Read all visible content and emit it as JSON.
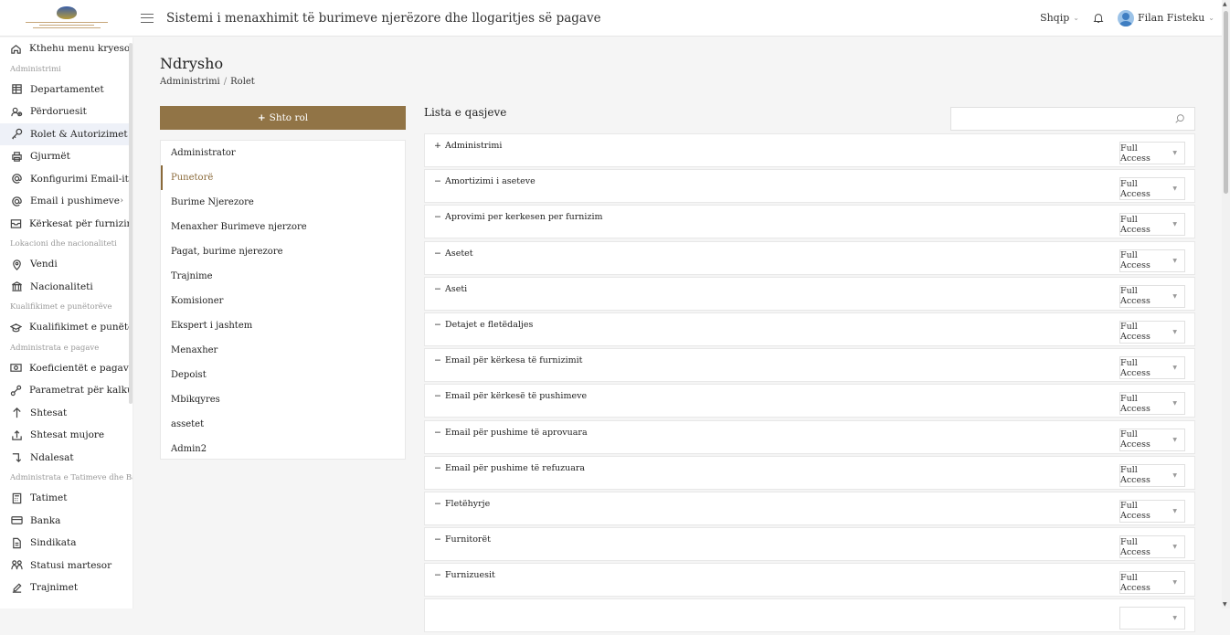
{
  "header": {
    "app_title": "Sistemi i menaxhimit të burimeve njerëzore dhe llogaritjes së pagave",
    "language": "Shqip",
    "user_name": "Filan Fisteku"
  },
  "sidebar": {
    "items": [
      {
        "type": "item",
        "label": "Kthehu menu kryesore",
        "icon": "home-icon"
      },
      {
        "type": "section",
        "label": "Administrimi"
      },
      {
        "type": "item",
        "label": "Departamentet",
        "icon": "grid-icon"
      },
      {
        "type": "item",
        "label": "Përdoruesit",
        "icon": "users-icon"
      },
      {
        "type": "item",
        "label": "Rolet & Autorizimet",
        "icon": "key-icon",
        "active": true
      },
      {
        "type": "item",
        "label": "Gjurmët",
        "icon": "printer-icon"
      },
      {
        "type": "item",
        "label": "Konfigurimi Email-it",
        "icon": "at-icon"
      },
      {
        "type": "item",
        "label": "Email i pushimeve",
        "icon": "at-icon",
        "arrow": true
      },
      {
        "type": "item",
        "label": "Kërkesat për furnizim",
        "icon": "inbox-icon"
      },
      {
        "type": "section",
        "label": "Lokacioni dhe nacionaliteti"
      },
      {
        "type": "item",
        "label": "Vendi",
        "icon": "location-icon"
      },
      {
        "type": "item",
        "label": "Nacionaliteti",
        "icon": "bank-icon"
      },
      {
        "type": "section",
        "label": "Kualifikimet e punëtorëve"
      },
      {
        "type": "item",
        "label": "Kualifikimet e punëtorëve",
        "icon": "graduation-icon"
      },
      {
        "type": "section",
        "label": "Administrata e pagave"
      },
      {
        "type": "item",
        "label": "Koeficientët e pagave",
        "icon": "money-icon"
      },
      {
        "type": "item",
        "label": "Parametrat për kalkulim",
        "icon": "nodes-icon"
      },
      {
        "type": "item",
        "label": "Shtesat",
        "icon": "arrow-up-icon"
      },
      {
        "type": "item",
        "label": "Shtesat mujore",
        "icon": "upload-icon"
      },
      {
        "type": "item",
        "label": "Ndalesat",
        "icon": "arrow-down-right-icon"
      },
      {
        "type": "section",
        "label": "Administrata e Tatimeve dhe Bankave"
      },
      {
        "type": "item",
        "label": "Tatimet",
        "icon": "calculator-icon"
      },
      {
        "type": "item",
        "label": "Banka",
        "icon": "card-icon"
      },
      {
        "type": "item",
        "label": "Sindikata",
        "icon": "document-icon"
      },
      {
        "type": "item",
        "label": "Statusi martesor",
        "icon": "people-icon"
      },
      {
        "type": "item",
        "label": "Trajnimet",
        "icon": "edit-icon"
      }
    ]
  },
  "page": {
    "title": "Ndrysho",
    "breadcrumb": [
      "Administrimi",
      "Rolet"
    ],
    "breadcrumb_sep": "/",
    "add_role_label": "Shto rol",
    "access_list_title": "Lista e qasjeve",
    "search_placeholder": ""
  },
  "roles": [
    {
      "label": "Administrator"
    },
    {
      "label": "Punetorë",
      "selected": true
    },
    {
      "label": "Burime Njerezore"
    },
    {
      "label": "Menaxher Burimeve njerzore"
    },
    {
      "label": "Pagat, burime njerezore"
    },
    {
      "label": "Trajnime"
    },
    {
      "label": "Komisioner"
    },
    {
      "label": "Ekspert i jashtem"
    },
    {
      "label": "Menaxher"
    },
    {
      "label": "Depoist"
    },
    {
      "label": "Mbikqyres"
    },
    {
      "label": "assetet"
    },
    {
      "label": "Admin2"
    }
  ],
  "permissions": [
    {
      "prefix": "+",
      "name": "Administrimi",
      "access": "Full Access"
    },
    {
      "prefix": "−",
      "name": "Amortizimi i aseteve",
      "access": "Full Access"
    },
    {
      "prefix": "−",
      "name": "Aprovimi per kerkesen per furnizim",
      "access": "Full Access"
    },
    {
      "prefix": "−",
      "name": "Asetet",
      "access": "Full Access"
    },
    {
      "prefix": "−",
      "name": "Aseti",
      "access": "Full Access"
    },
    {
      "prefix": "−",
      "name": "Detajet e fletëdaljes",
      "access": "Full Access"
    },
    {
      "prefix": "−",
      "name": "Email për kërkesa të furnizimit",
      "access": "Full Access"
    },
    {
      "prefix": "−",
      "name": "Email për kërkesë të pushimeve",
      "access": "Full Access"
    },
    {
      "prefix": "−",
      "name": "Email për pushime të aprovuara",
      "access": "Full Access"
    },
    {
      "prefix": "−",
      "name": "Email për pushime të refuzuara",
      "access": "Full Access"
    },
    {
      "prefix": "−",
      "name": "Fletëhyrje",
      "access": "Full Access"
    },
    {
      "prefix": "−",
      "name": "Furnitorët",
      "access": "Full Access"
    },
    {
      "prefix": "−",
      "name": "Furnizuesit",
      "access": "Full Access"
    },
    {
      "prefix": "",
      "name": "",
      "access": ""
    }
  ]
}
